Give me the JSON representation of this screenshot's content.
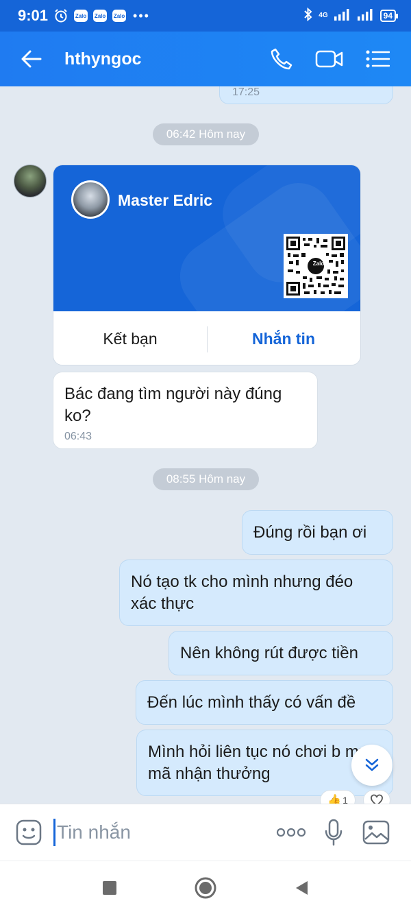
{
  "status_bar": {
    "time": "9:01",
    "notification_apps": [
      "Zalo",
      "Zalo",
      "Zalo"
    ],
    "more": "•••",
    "network": "4G",
    "battery": "94"
  },
  "header": {
    "contact_name": "hthyngoc",
    "actions": [
      "phone-icon",
      "video-call-icon",
      "menu-icon"
    ]
  },
  "messages": {
    "previous_time": "17:25",
    "date_1": "06:42 Hôm nay",
    "card": {
      "name": "Master Edric",
      "qr_logo": "Zalo",
      "add_friend": "Kết bạn",
      "send_message": "Nhắn tin"
    },
    "incoming_1": {
      "text": "Bác đang tìm người này đúng ko?",
      "time": "06:43"
    },
    "date_2": "08:55 Hôm nay",
    "outgoing": [
      "Đúng rồi bạn ơi",
      "Nó tạo tk cho mình nhưng đéo xác thực",
      "Nên không rút được tiền",
      "Đến lúc mình thấy có vấn đề",
      "Mình hỏi liên tục nó chơi b mua mã nhận thưởng"
    ],
    "reaction_count": "1"
  },
  "input": {
    "placeholder": "Tin nhắn"
  },
  "colors": {
    "accent": "#1565d8",
    "header": "#1e80f3",
    "chat_bg": "#e2e9f1",
    "outgoing_bubble": "#d5eafd"
  }
}
